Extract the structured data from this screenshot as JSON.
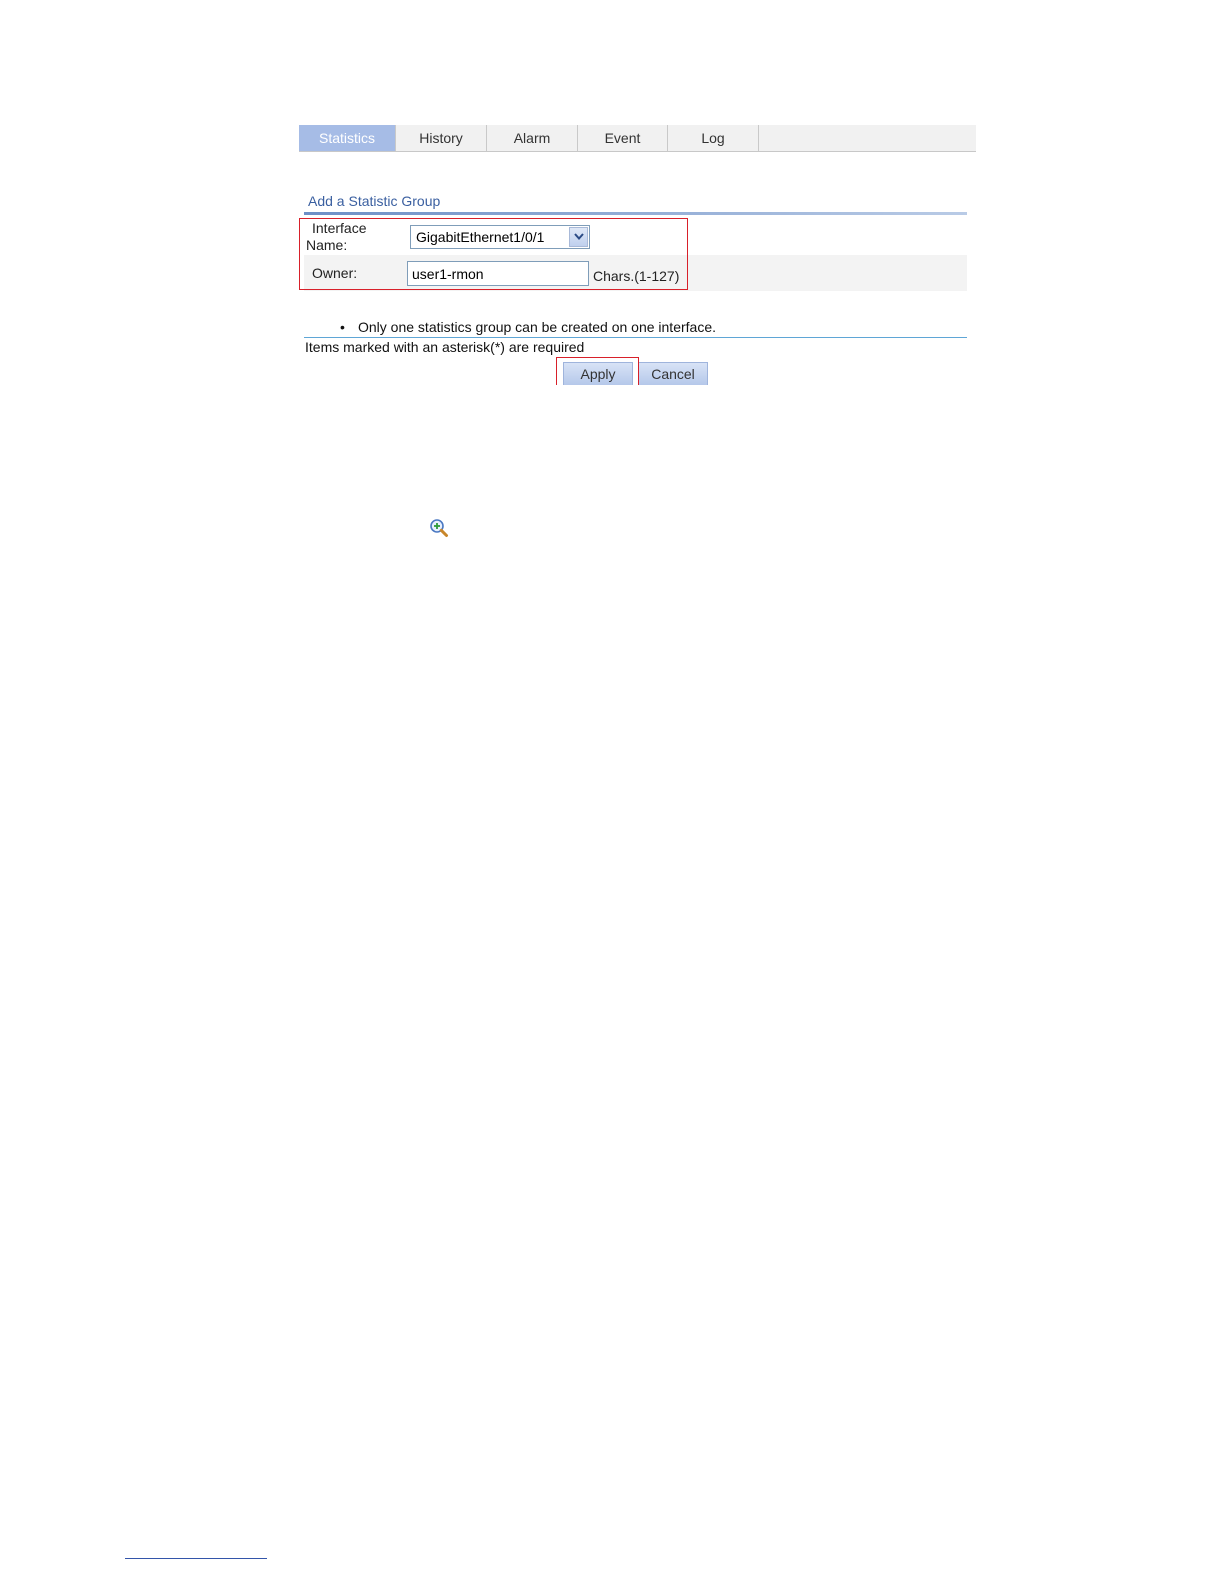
{
  "tabs": [
    {
      "label": "Statistics",
      "active": true
    },
    {
      "label": "History",
      "active": false
    },
    {
      "label": "Alarm",
      "active": false
    },
    {
      "label": "Event",
      "active": false
    },
    {
      "label": "Log",
      "active": false
    }
  ],
  "section": {
    "title": "Add a Statistic Group"
  },
  "form": {
    "interface_label": "Interface Name:",
    "interface_value": "GigabitEthernet1/0/1",
    "owner_label": "Owner:",
    "owner_value": "user1-rmon",
    "owner_hint": "Chars.(1-127)"
  },
  "notes": {
    "bullet": "•",
    "item": "Only one statistics group can be created on one interface.",
    "required": "Items marked with an asterisk(*) are required"
  },
  "buttons": {
    "apply": "Apply",
    "cancel": "Cancel"
  },
  "icons": {
    "dropdown": "chevron-down-icon",
    "zoom": "zoom-in-icon"
  },
  "colors": {
    "tab_active_bg": "#a6bce6",
    "highlight": "#d8202a",
    "title_text": "#3a5fa0"
  }
}
